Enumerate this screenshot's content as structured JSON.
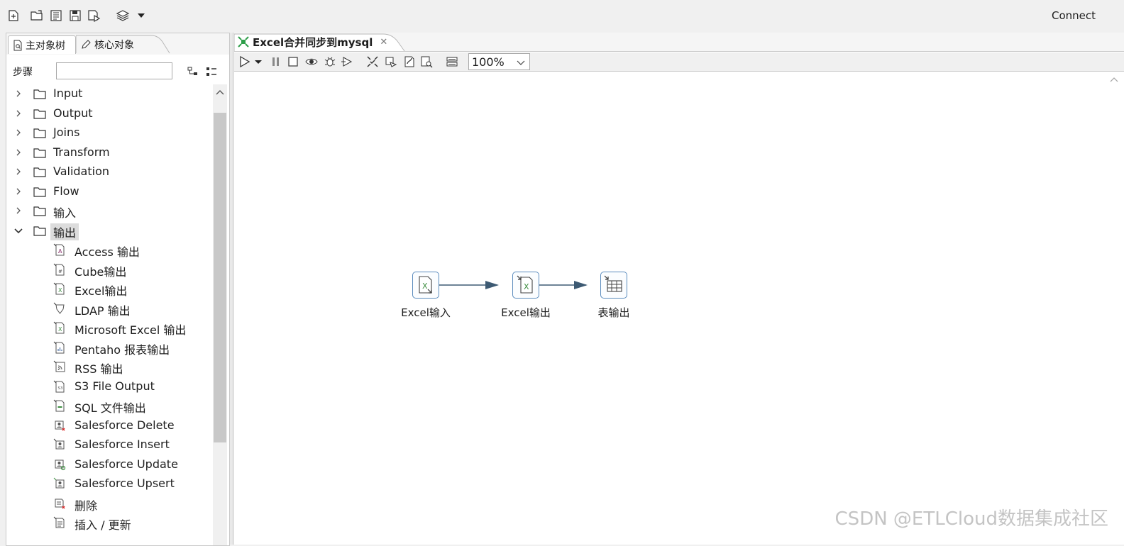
{
  "toolbar": {
    "icons": [
      "new-file-icon",
      "open-file-icon",
      "explore-repository-icon",
      "save-icon",
      "save-as-icon",
      "layers-icon",
      "dropdown-arrow-icon"
    ],
    "connect_label": "Connect"
  },
  "left_panel": {
    "tabs": [
      {
        "label": "主对象树",
        "icon": "doc-search-icon",
        "active": true
      },
      {
        "label": "核心对象",
        "icon": "pencil-icon",
        "active": false
      }
    ],
    "steps_label": "步骤",
    "search_value": "",
    "folders": [
      {
        "label": "Input",
        "expanded": false
      },
      {
        "label": "Output",
        "expanded": false
      },
      {
        "label": "Joins",
        "expanded": false
      },
      {
        "label": "Transform",
        "expanded": false
      },
      {
        "label": "Validation",
        "expanded": false
      },
      {
        "label": "Flow",
        "expanded": false
      },
      {
        "label": "输入",
        "expanded": false
      },
      {
        "label": "输出",
        "expanded": true
      }
    ],
    "output_items": [
      {
        "label": "Access 输出",
        "icon": "access-output-icon"
      },
      {
        "label": "Cube输出",
        "icon": "cube-output-icon"
      },
      {
        "label": "Excel输出",
        "icon": "excel-output-icon"
      },
      {
        "label": "LDAP 输出",
        "icon": "ldap-output-icon"
      },
      {
        "label": "Microsoft Excel 输出",
        "icon": "ms-excel-output-icon"
      },
      {
        "label": "Pentaho 报表输出",
        "icon": "report-output-icon"
      },
      {
        "label": "RSS 输出",
        "icon": "rss-output-icon"
      },
      {
        "label": "S3 File Output",
        "icon": "s3-output-icon"
      },
      {
        "label": "SQL 文件输出",
        "icon": "sql-output-icon"
      },
      {
        "label": "Salesforce Delete",
        "icon": "salesforce-delete-icon"
      },
      {
        "label": "Salesforce Insert",
        "icon": "salesforce-insert-icon"
      },
      {
        "label": "Salesforce Update",
        "icon": "salesforce-update-icon"
      },
      {
        "label": "Salesforce Upsert",
        "icon": "salesforce-upsert-icon"
      },
      {
        "label": "删除",
        "icon": "delete-icon"
      },
      {
        "label": "插入 / 更新",
        "icon": "insert-update-icon"
      }
    ]
  },
  "editor": {
    "tab_title": "Excel合并同步到mysql",
    "zoom": "100%",
    "toolbar_icons": [
      "run-icon",
      "run-options-dropdown-icon",
      "pause-icon",
      "stop-icon",
      "preview-icon",
      "debug-icon",
      "replay-icon",
      "verify-icon",
      "impact-icon",
      "sql-icon",
      "explore-db-icon",
      "results-icon"
    ],
    "nodes": [
      {
        "label": "Excel输入",
        "icon": "excel-input-icon"
      },
      {
        "label": "Excel输出",
        "icon": "excel-output-icon"
      },
      {
        "label": "表输出",
        "icon": "table-output-icon"
      }
    ],
    "hops": [
      {
        "from": "Excel输入",
        "to": "Excel输出"
      },
      {
        "from": "Excel输出",
        "to": "表输出"
      }
    ]
  },
  "watermark": "CSDN @ETLCloud数据集成社区",
  "colors": {
    "node_border": "#5a8bbd",
    "hop_arrow": "#3d5a73",
    "excel_green": "#3e8e41",
    "toolbar_bg": "#f0f0f0"
  }
}
